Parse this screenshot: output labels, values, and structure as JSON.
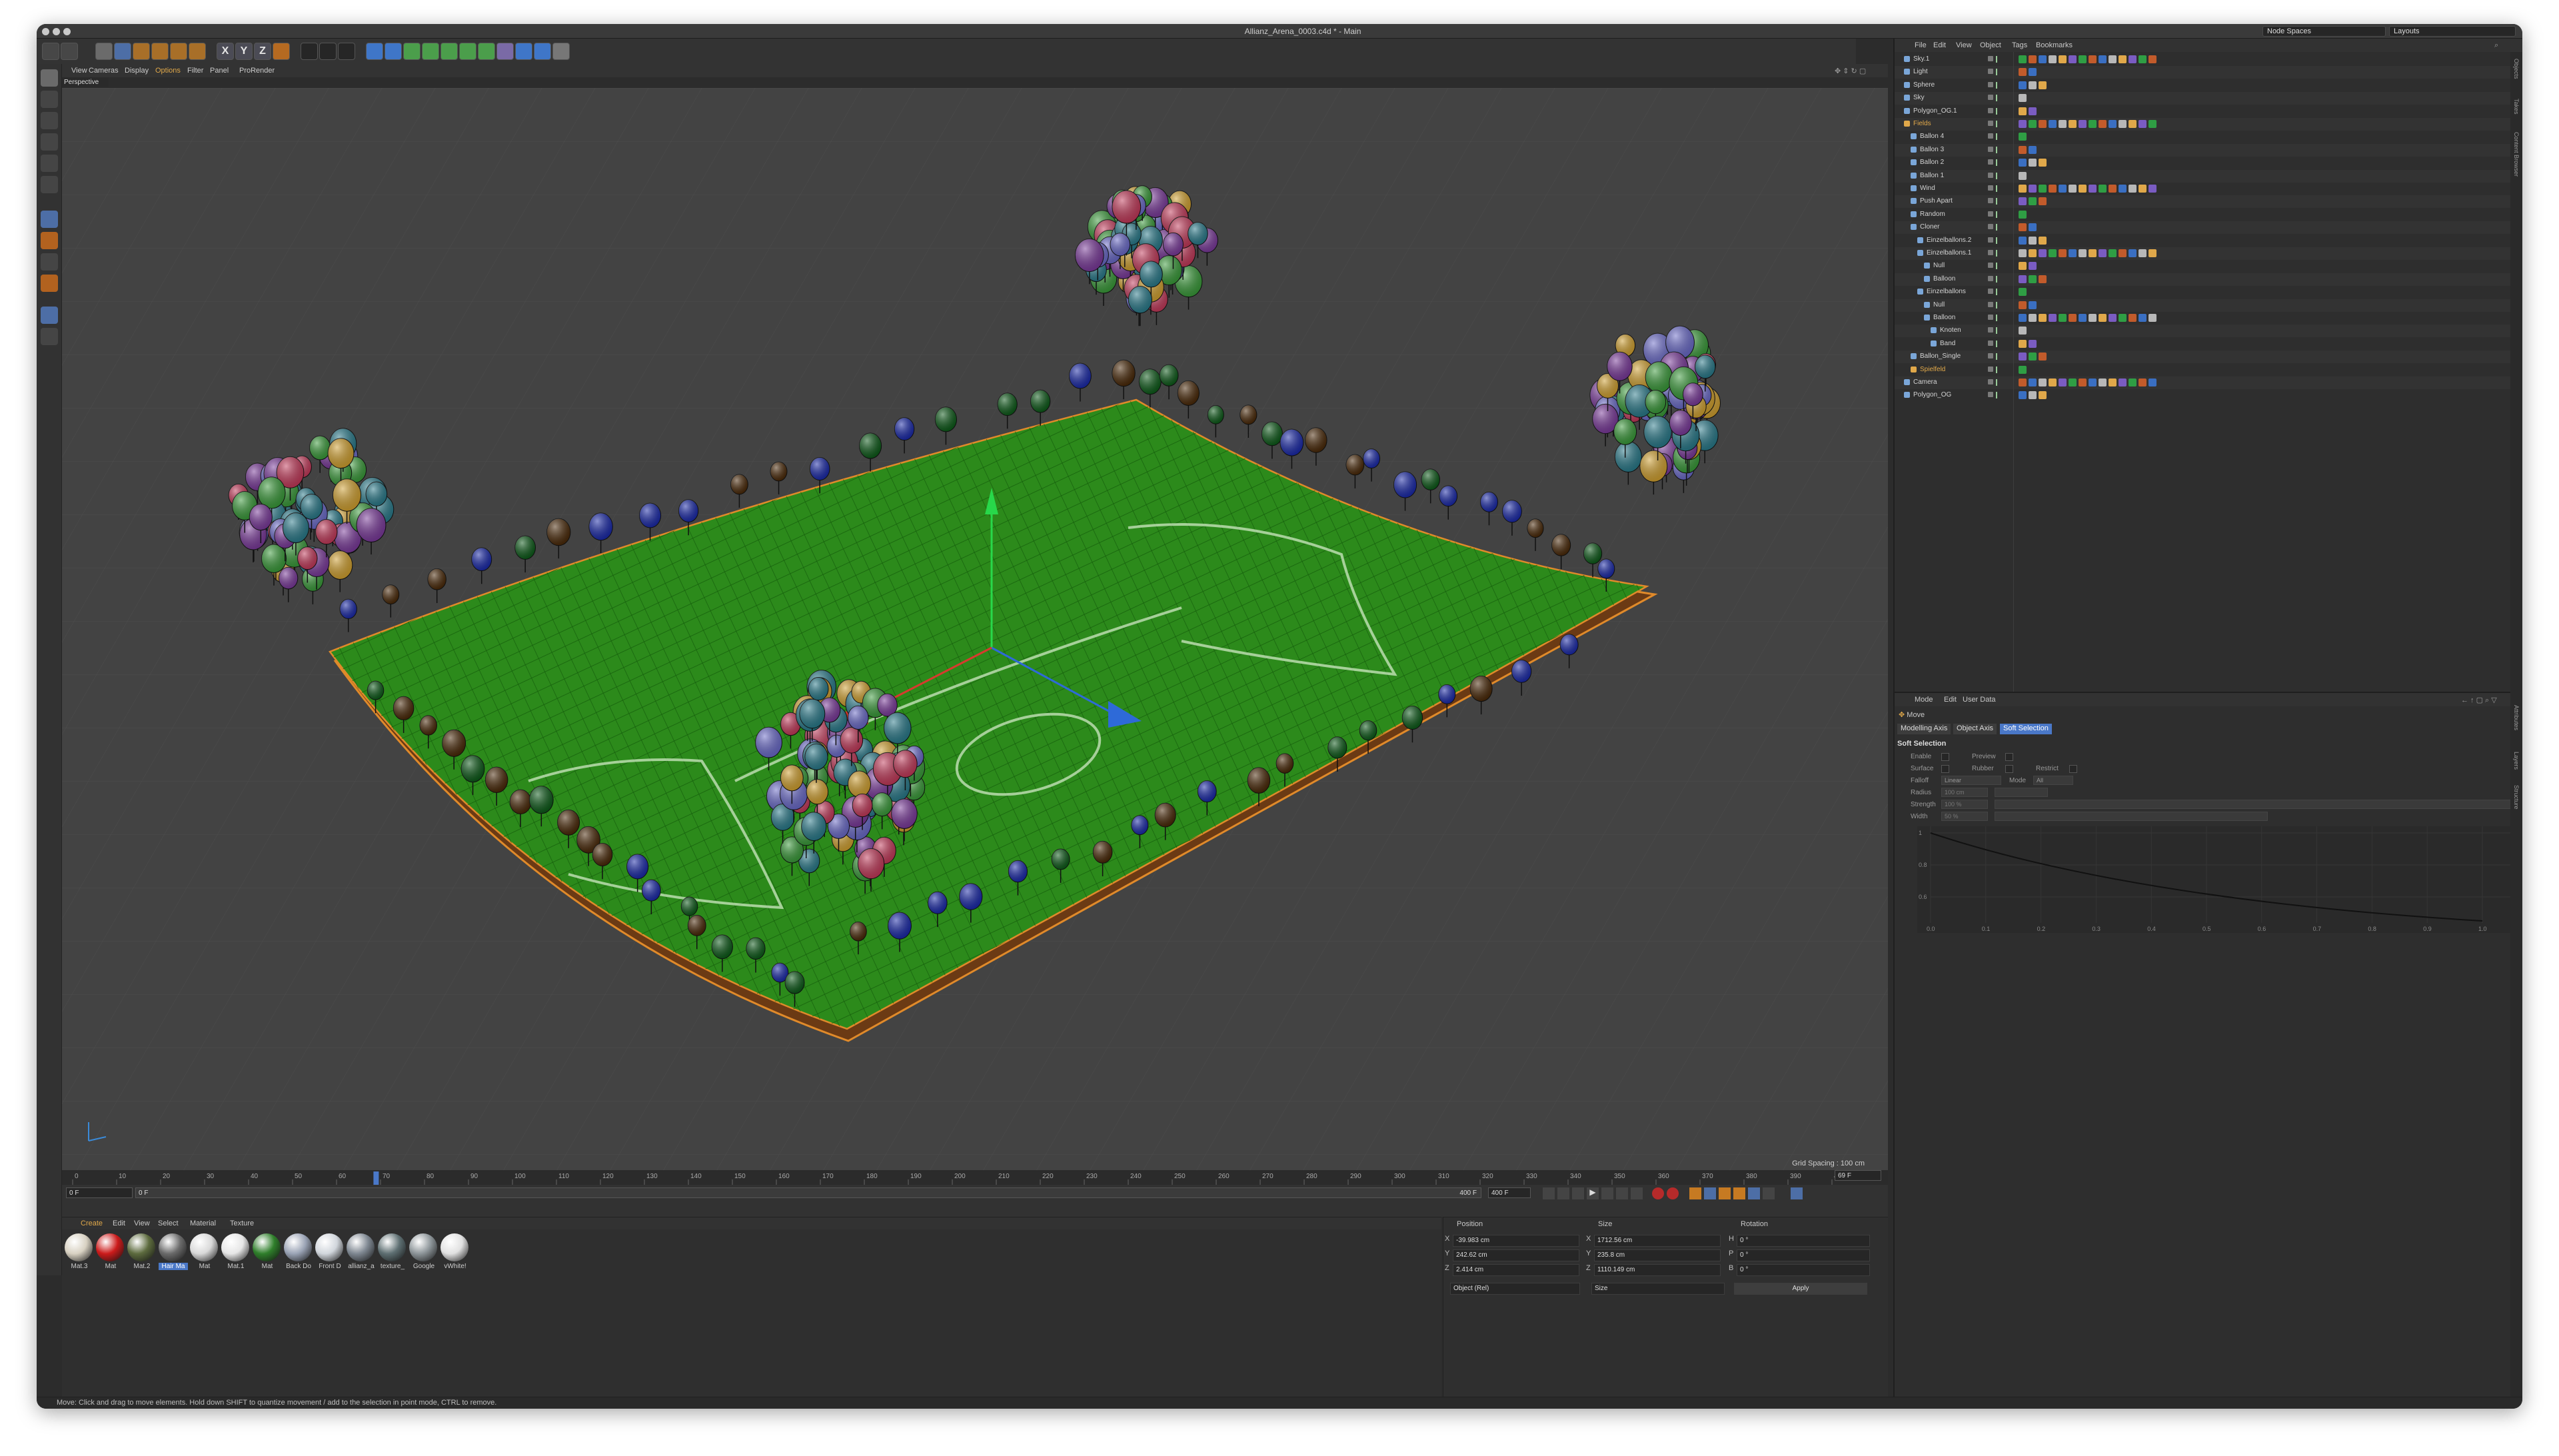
{
  "window": {
    "title": "Allianz_Arena_0003.c4d * - Main"
  },
  "top_right": {
    "node_spaces": "Node Spaces",
    "layouts": "Layouts"
  },
  "viewport": {
    "menu": [
      "View",
      "Cameras",
      "Display",
      "Options",
      "Filter",
      "Panel",
      "ProRender"
    ],
    "camera": "Perspective",
    "grid_spacing": "Grid Spacing : 100 cm"
  },
  "timeline": {
    "ticks": [
      "0",
      "10",
      "20",
      "30",
      "40",
      "50",
      "60",
      "70",
      "80",
      "90",
      "100",
      "110",
      "120",
      "130",
      "140",
      "150",
      "160",
      "170",
      "180",
      "190",
      "200",
      "210",
      "220",
      "230",
      "240",
      "250",
      "260",
      "270",
      "280",
      "290",
      "300",
      "310",
      "320",
      "330",
      "340",
      "350",
      "360",
      "370",
      "380",
      "390",
      "400"
    ],
    "start_frame": "0 F",
    "min_frame": "0 F",
    "max_frame": "400 F",
    "end_frame": "400 F",
    "current_frame": "69 F",
    "current_value": 69
  },
  "materials": {
    "menu": [
      "Create",
      "Edit",
      "View",
      "Select",
      "Material",
      "Texture"
    ],
    "items": [
      {
        "label": "Mat.3",
        "color": "#d8d1c2"
      },
      {
        "label": "Mat",
        "color": "#cc1b1b"
      },
      {
        "label": "Mat.2",
        "color": "#5d6b3e"
      },
      {
        "label": "Hair Ma",
        "color": "#6b6b6b"
      },
      {
        "label": "Mat",
        "color": "#d9d9d9"
      },
      {
        "label": "Mat.1",
        "color": "#e6e6e6"
      },
      {
        "label": "Mat",
        "color": "#2f7f2b"
      },
      {
        "label": "Back Do",
        "color": "#9aa3b5"
      },
      {
        "label": "Front D",
        "color": "#d1d6dc"
      },
      {
        "label": "allianz_a",
        "color": "#7e8791"
      },
      {
        "label": "texture_",
        "color": "#5e6f72"
      },
      {
        "label": "Google",
        "color": "#8d9599"
      },
      {
        "label": "vWhite!",
        "color": "#e1e1e1"
      }
    ]
  },
  "coordinates": {
    "headers": {
      "position": "Position",
      "size": "Size",
      "rotation": "Rotation"
    },
    "rows": [
      {
        "axis": "X",
        "pos": "-39.983 cm",
        "size_axis": "X",
        "size": "1712.56 cm",
        "rot_axis": "H",
        "rot": "0 °"
      },
      {
        "axis": "Y",
        "pos": "242.62 cm",
        "size_axis": "Y",
        "size": "235.8 cm",
        "rot_axis": "P",
        "rot": "0 °"
      },
      {
        "axis": "Z",
        "pos": "2.414 cm",
        "size_axis": "Z",
        "size": "1110.149 cm",
        "rot_axis": "B",
        "rot": "0 °"
      }
    ],
    "mode": "Object (Rel)",
    "size_mode": "Size",
    "apply": "Apply"
  },
  "status": "Move: Click and drag to move elements. Hold down SHIFT to quantize movement / add to the selection in point mode, CTRL to remove.",
  "object_manager": {
    "menu": [
      "File",
      "Edit",
      "View",
      "Object",
      "Tags",
      "Bookmarks"
    ],
    "objects": [
      {
        "name": "Sky.1",
        "indent": 0
      },
      {
        "name": "Light",
        "indent": 0
      },
      {
        "name": "Sphere",
        "indent": 0
      },
      {
        "name": "Sky",
        "indent": 0
      },
      {
        "name": "Polygon_OG.1",
        "indent": 0
      },
      {
        "name": "Fields",
        "indent": 0,
        "highlight": true
      },
      {
        "name": "Ballon 4",
        "indent": 1
      },
      {
        "name": "Ballon 3",
        "indent": 1
      },
      {
        "name": "Ballon 2",
        "indent": 1
      },
      {
        "name": "Ballon 1",
        "indent": 1
      },
      {
        "name": "Wind",
        "indent": 1
      },
      {
        "name": "Push Apart",
        "indent": 1
      },
      {
        "name": "Random",
        "indent": 1
      },
      {
        "name": "Cloner",
        "indent": 1
      },
      {
        "name": "Einzelballons.2",
        "indent": 2
      },
      {
        "name": "Einzelballons.1",
        "indent": 2
      },
      {
        "name": "Null",
        "indent": 3
      },
      {
        "name": "Balloon",
        "indent": 3
      },
      {
        "name": "Einzelballons",
        "indent": 2
      },
      {
        "name": "Null",
        "indent": 3
      },
      {
        "name": "Balloon",
        "indent": 3
      },
      {
        "name": "Knoten",
        "indent": 4
      },
      {
        "name": "Band",
        "indent": 4
      },
      {
        "name": "Ballon_Single",
        "indent": 1
      },
      {
        "name": "Spielfeld",
        "indent": 1,
        "highlight": true
      },
      {
        "name": "Camera",
        "indent": 0
      },
      {
        "name": "Polygon_OG",
        "indent": 0
      }
    ]
  },
  "attributes": {
    "menu": [
      "Mode",
      "Edit",
      "User Data"
    ],
    "tool": "Move",
    "tabs": [
      "Modelling Axis",
      "Object Axis",
      "Soft Selection"
    ],
    "active_tab": "Soft Selection",
    "section": "Soft Selection",
    "fields": {
      "enable": "Enable",
      "preview": "Preview",
      "surface": "Surface",
      "rubber": "Rubber",
      "restrict": "Restrict",
      "falloff": "Falloff",
      "falloff_value": "Linear",
      "mode": "Mode",
      "mode_value": "All",
      "radius": "Radius",
      "radius_value": "100 cm",
      "strength": "Strength",
      "strength_value": "100 %",
      "width": "Width",
      "width_value": "50 %"
    },
    "curve_y": [
      "1",
      "0.8",
      "0.6"
    ],
    "curve_x": [
      "0.0",
      "0.1",
      "0.2",
      "0.3",
      "0.4",
      "0.5",
      "0.6",
      "0.7",
      "0.8",
      "0.9",
      "1.0"
    ]
  },
  "side_tabs": [
    "Objects",
    "Takes",
    "Content Browser",
    "Attributes",
    "Layers",
    "Structure"
  ]
}
